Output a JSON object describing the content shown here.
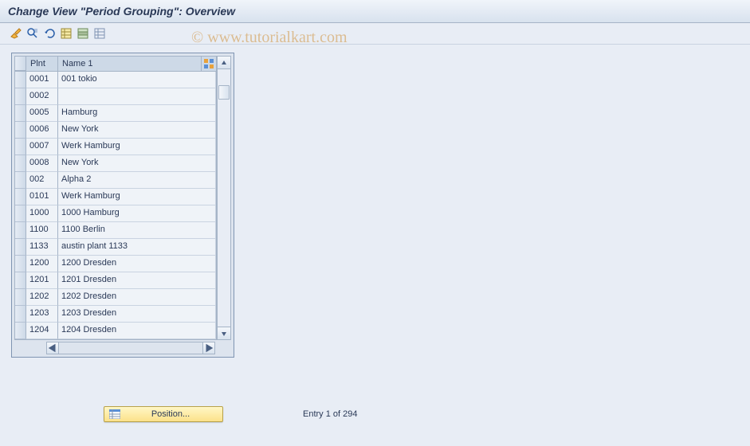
{
  "title": "Change View \"Period Grouping\": Overview",
  "watermark": "© www.tutorialkart.com",
  "toolbar": {
    "icons": [
      "change-display-icon",
      "find-icon",
      "undo-icon",
      "select-all-icon",
      "select-block-icon",
      "deselect-all-icon"
    ]
  },
  "table": {
    "columns": {
      "plnt": "Plnt",
      "name1": "Name 1"
    },
    "rows": [
      {
        "plnt": "0001",
        "name1": "001 tokio"
      },
      {
        "plnt": "0002",
        "name1": ""
      },
      {
        "plnt": "0005",
        "name1": "Hamburg"
      },
      {
        "plnt": "0006",
        "name1": "New York"
      },
      {
        "plnt": "0007",
        "name1": "Werk Hamburg"
      },
      {
        "plnt": "0008",
        "name1": "New York"
      },
      {
        "plnt": "002",
        "name1": "Alpha 2"
      },
      {
        "plnt": "0101",
        "name1": "Werk Hamburg"
      },
      {
        "plnt": "1000",
        "name1": "1000 Hamburg"
      },
      {
        "plnt": "1100",
        "name1": "1100 Berlin"
      },
      {
        "plnt": "1133",
        "name1": "austin plant 1133"
      },
      {
        "plnt": "1200",
        "name1": "1200 Dresden"
      },
      {
        "plnt": "1201",
        "name1": "1201 Dresden"
      },
      {
        "plnt": "1202",
        "name1": "1202 Dresden"
      },
      {
        "plnt": "1203",
        "name1": "1203 Dresden"
      },
      {
        "plnt": "1204",
        "name1": "1204 Dresden"
      }
    ]
  },
  "footer": {
    "position_label": "Position...",
    "entry_status": "Entry 1 of 294"
  }
}
